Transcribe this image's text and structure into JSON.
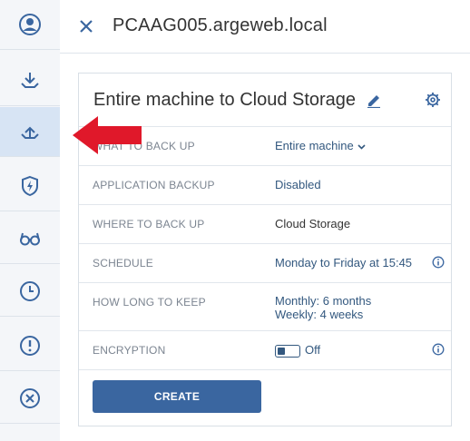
{
  "colors": {
    "accent": "#3a66a0",
    "link": "#33587f",
    "arrow": "#e0182a",
    "sidebar_active": "#d7e4f4"
  },
  "sidebar": {
    "items": [
      {
        "icon": "user-icon",
        "active": false
      },
      {
        "icon": "download-icon",
        "active": false
      },
      {
        "icon": "backup-icon",
        "active": true
      },
      {
        "icon": "shield-lightning-icon",
        "active": false
      },
      {
        "icon": "glasses-icon",
        "active": false
      },
      {
        "icon": "clock-icon",
        "active": false
      },
      {
        "icon": "alert-icon",
        "active": false
      },
      {
        "icon": "cancel-circle-icon",
        "active": false
      }
    ]
  },
  "header": {
    "title": "PCAAG005.argeweb.local"
  },
  "plan": {
    "title": "Entire machine to Cloud Storage",
    "rows": [
      {
        "label": "What to back up",
        "value": "Entire machine"
      },
      {
        "label": "Application backup",
        "value": "Disabled"
      },
      {
        "label": "Where to back up",
        "value": "Cloud Storage"
      },
      {
        "label": "Schedule",
        "value": "Monday to Friday at 15:45"
      },
      {
        "label": "How long to keep",
        "value": "Monthly: 6 months",
        "value2": "Weekly: 4 weeks"
      },
      {
        "label": "Encryption",
        "value": "Off"
      }
    ],
    "create_label": "CREATE"
  }
}
